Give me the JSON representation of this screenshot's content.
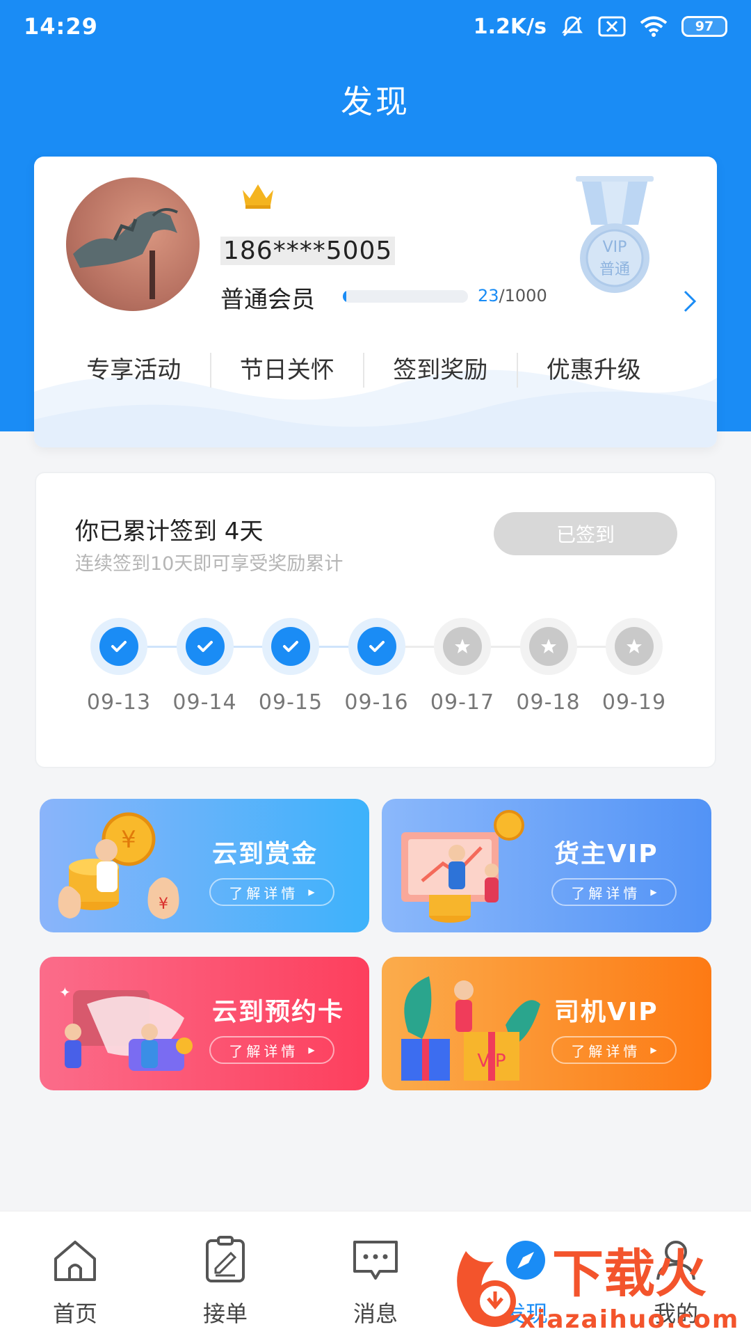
{
  "status_bar": {
    "time": "14:29",
    "net_speed": "1.2K/s",
    "battery": "97"
  },
  "page_title": "发现",
  "member": {
    "phone": "186****5005",
    "level": "普通会员",
    "points_current": "23",
    "points_total": "/1000",
    "progress_fraction": 0.023,
    "medal_line1": "VIP",
    "medal_line2": "普通",
    "perks": [
      "专享活动",
      "节日关怀",
      "签到奖励",
      "优惠升级"
    ]
  },
  "checkin": {
    "title": "你已累计签到 4天",
    "subtitle": "连续签到10天即可享受奖励累计",
    "button_label": "已签到",
    "days": [
      {
        "date": "09-13",
        "done": true
      },
      {
        "date": "09-14",
        "done": true
      },
      {
        "date": "09-15",
        "done": true
      },
      {
        "date": "09-16",
        "done": true
      },
      {
        "date": "09-17",
        "done": false
      },
      {
        "date": "09-18",
        "done": false
      },
      {
        "date": "09-19",
        "done": false
      }
    ]
  },
  "promos": [
    {
      "title": "云到赏金",
      "button": "了解详情"
    },
    {
      "title": "货主VIP",
      "button": "了解详情"
    },
    {
      "title": "云到预约卡",
      "button": "了解详情"
    },
    {
      "title": "司机VIP",
      "button": "了解详情"
    }
  ],
  "nav": [
    {
      "label": "首页",
      "icon": "home-icon"
    },
    {
      "label": "接单",
      "icon": "clipboard-icon"
    },
    {
      "label": "消息",
      "icon": "message-icon"
    },
    {
      "label": "发现",
      "icon": "discover-icon"
    },
    {
      "label": "我的",
      "icon": "profile-icon"
    }
  ],
  "watermark": {
    "brand": "下载火",
    "url": "xiazaihuo.com"
  },
  "colors": {
    "primary": "#1a8cf5",
    "background": "#f4f5f7"
  }
}
